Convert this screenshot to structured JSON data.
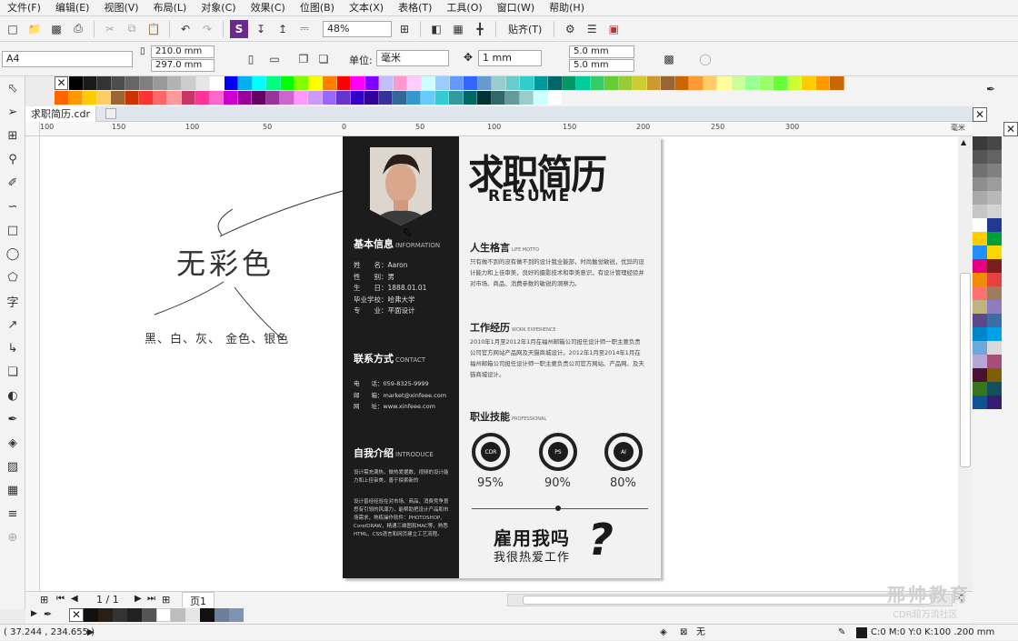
{
  "menu": [
    "文件(F)",
    "编辑(E)",
    "视图(V)",
    "布局(L)",
    "对象(C)",
    "效果(C)",
    "位图(B)",
    "文本(X)",
    "表格(T)",
    "工具(O)",
    "窗口(W)",
    "帮助(H)"
  ],
  "toolbar": {
    "zoom": "48%",
    "snap": "贴齐(T)"
  },
  "propbar": {
    "page_size": "A4",
    "width": "210.0 mm",
    "height": "297.0 mm",
    "unit_label": "单位:",
    "unit": "毫米",
    "nudge": "1 mm",
    "dup_x": "5.0 mm",
    "dup_y": "5.0 mm"
  },
  "tab": {
    "doc_name": "求职简历.cdr"
  },
  "ruler": {
    "h_labels": [
      "100",
      "150",
      "100",
      "50",
      "0",
      "50",
      "100",
      "150",
      "200",
      "250",
      "300"
    ],
    "units": "毫米"
  },
  "canvas_note": {
    "title": "无彩色",
    "items": "黑、白、灰、 金色、银色"
  },
  "resume": {
    "title_cn": "求职简历",
    "title_en": "RESUME",
    "basic": {
      "title": "基本信息",
      "sub": "INFORMATION",
      "rows": [
        {
          "k": "姓　　名：",
          "v": "Aaron"
        },
        {
          "k": "性　　别：",
          "v": "男"
        },
        {
          "k": "生　　日：",
          "v": "1888.01.01"
        },
        {
          "k": "毕业学校：",
          "v": "哈弗大学"
        },
        {
          "k": "专　　业：",
          "v": "平面设计"
        }
      ]
    },
    "contact": {
      "title": "联系方式",
      "sub": "CONTACT",
      "rows": [
        {
          "k": "电　　话：",
          "v": "059-8325-9999"
        },
        {
          "k": "邮　　箱：",
          "v": "market@xinfeee.com"
        },
        {
          "k": "网　　址：",
          "v": "www.xinfeee.com"
        }
      ]
    },
    "intro": {
      "title": "自我介绍",
      "sub": "INTRODUCE",
      "p1": "设计需充满热，做热爱据数，视频的设计能力和上佳审美，善于探索新的",
      "p2": "设计曾经经验在对市场、商品、消费竞争意思有引领的风潮力，能帮助把设计产品和市场需求，熟练操作软件：PHOTOSHOP、CorelDRAW，精通三维图和MAC等，熟悉HTML、CSS语言和网页建立工艺流程。"
    },
    "motto": {
      "title": "人生格言",
      "sub": "LIFE MOTTO",
      "text": "只有做不到的没有做不到的设计我全能部，时尚触觉敏锐，优异的设计能力和上佳审美，良好的摄影技术和审美意识，有设计管理经验并对市场、商品、消费参数的敏锐的洞察力。"
    },
    "work": {
      "title": "工作经历",
      "sub": "WORK EXPERIENCE",
      "text": "2010年1月至2012年1月在福州邮箱公司担任设计师一职主要负责公司官方网站产品网及天猫商城设计。2012年1月至2014年1月在福州邮箱公司担任设计师一职主要负责公司官方网站、产品网、及天猫商城设计。"
    },
    "skills": {
      "title": "职业技能",
      "sub": "PROFESSIONAL",
      "items": [
        {
          "name": "CDR",
          "pct": "95%"
        },
        {
          "name": "PS",
          "pct": "90%"
        },
        {
          "name": "AI",
          "pct": "80%"
        }
      ]
    },
    "slogan1": "雇用我吗",
    "slogan2": "我很热爱工作",
    "slogan_mark": "?"
  },
  "bottom": {
    "page_count": "1 / 1",
    "page_tab": "页1"
  },
  "status": {
    "coords": "( 37.244 , 234.655 )",
    "fill": "无",
    "outline": "C:0 M:0 Y:0 K:100   .200 mm"
  },
  "watermark": {
    "line1": "邢帅教育",
    "line2": "CDR超万流社区"
  },
  "palette": {
    "row1": [
      "#000000",
      "#1a1a1a",
      "#333333",
      "#4d4d4d",
      "#666666",
      "#808080",
      "#999999",
      "#b3b3b3",
      "#cccccc",
      "#e6e6e6",
      "#ffffff",
      "#0000ff",
      "#00b0f0",
      "#00ffff",
      "#00ff80",
      "#00ff00",
      "#80ff00",
      "#ffff00",
      "#ff8000",
      "#ff0000",
      "#ff00ff",
      "#8000ff",
      "#c0c0ff",
      "#ff99cc",
      "#ffccff",
      "#ccffff",
      "#99ccff",
      "#6699ff",
      "#3366ff",
      "#6699cc",
      "#99cccc",
      "#66cccc",
      "#33cccc",
      "#009999",
      "#006666",
      "#009966",
      "#00cc99",
      "#33cc66",
      "#66cc33",
      "#99cc33",
      "#cccc33",
      "#cc9933",
      "#996633",
      "#cc6600",
      "#ff9933",
      "#ffcc66",
      "#ffff99",
      "#ccff99",
      "#99ff99",
      "#99ff66",
      "#66ff33",
      "#ccff33",
      "#ffcc00",
      "#ff9900",
      "#cc6600"
    ],
    "row2": [
      "#ff6600",
      "#ff9900",
      "#ffcc00",
      "#ffcc66",
      "#996633",
      "#cc3300",
      "#ff3333",
      "#ff6666",
      "#ff9999",
      "#cc3366",
      "#ff3399",
      "#ff66cc",
      "#cc00cc",
      "#990099",
      "#660066",
      "#993399",
      "#cc66cc",
      "#ff99ff",
      "#cc99ff",
      "#9966ff",
      "#6633cc",
      "#3300cc",
      "#330099",
      "#333399",
      "#336699",
      "#3399cc",
      "#66ccff",
      "#33cccc",
      "#339999",
      "#006666",
      "#003333",
      "#336666",
      "#669999",
      "#99cccc",
      "#ccffff",
      "#ffffff"
    ],
    "right": [
      "#3a3a3a",
      "#474747",
      "#555555",
      "#636363",
      "#717171",
      "#808080",
      "#8e8e8e",
      "#9c9c9c",
      "#aaaaaa",
      "#b8b8b8",
      "#c6c6c6",
      "#d4d4d4",
      "#ffffff",
      "#1f3a93",
      "#ffcc00",
      "#009f3c",
      "#1e90ff",
      "#ffd700",
      "#e60080",
      "#7a1f1f",
      "#f08c00",
      "#e64040",
      "#ff7070",
      "#9e7c5e",
      "#c2b280",
      "#8e7cc3",
      "#5d478b",
      "#3a6ea5",
      "#0085c8",
      "#00a0e9",
      "#6fa8dc",
      "#d9d9d9",
      "#b4a7d6",
      "#a64d79",
      "#4c1130",
      "#7f6000",
      "#38761d",
      "#134f5c",
      "#0b5394",
      "#351c75"
    ]
  }
}
